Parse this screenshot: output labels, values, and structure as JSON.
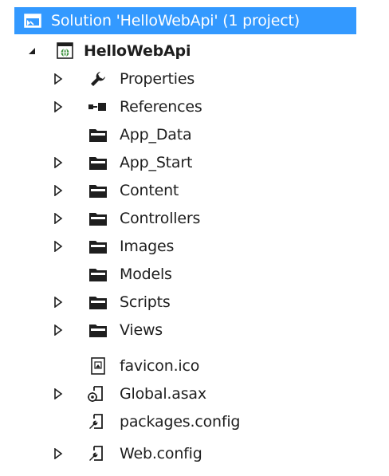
{
  "solution": {
    "label": "Solution 'HelloWebApi' (1 project)"
  },
  "project": {
    "label": "HelloWebApi"
  },
  "items": [
    {
      "label": "Properties",
      "icon": "wrench-icon",
      "expandable": true
    },
    {
      "label": "References",
      "icon": "references-icon",
      "expandable": true
    },
    {
      "label": "App_Data",
      "icon": "folder-icon",
      "expandable": false
    },
    {
      "label": "App_Start",
      "icon": "folder-icon",
      "expandable": true
    },
    {
      "label": "Content",
      "icon": "folder-icon",
      "expandable": true
    },
    {
      "label": "Controllers",
      "icon": "folder-icon",
      "expandable": true
    },
    {
      "label": "Images",
      "icon": "folder-icon",
      "expandable": true
    },
    {
      "label": "Models",
      "icon": "folder-icon",
      "expandable": false
    },
    {
      "label": "Scripts",
      "icon": "folder-icon",
      "expandable": true
    },
    {
      "label": "Views",
      "icon": "folder-icon",
      "expandable": true
    },
    {
      "label": "favicon.ico",
      "icon": "image-file-icon",
      "expandable": false
    },
    {
      "label": "Global.asax",
      "icon": "global-asax-icon",
      "expandable": true
    },
    {
      "label": "packages.config",
      "icon": "config-file-icon",
      "expandable": false
    },
    {
      "label": "Web.config",
      "icon": "config-file-icon",
      "expandable": true
    }
  ],
  "colors": {
    "selection": "#3399ff",
    "text": "#1e1e1e",
    "icon": "#1e1e1e"
  }
}
